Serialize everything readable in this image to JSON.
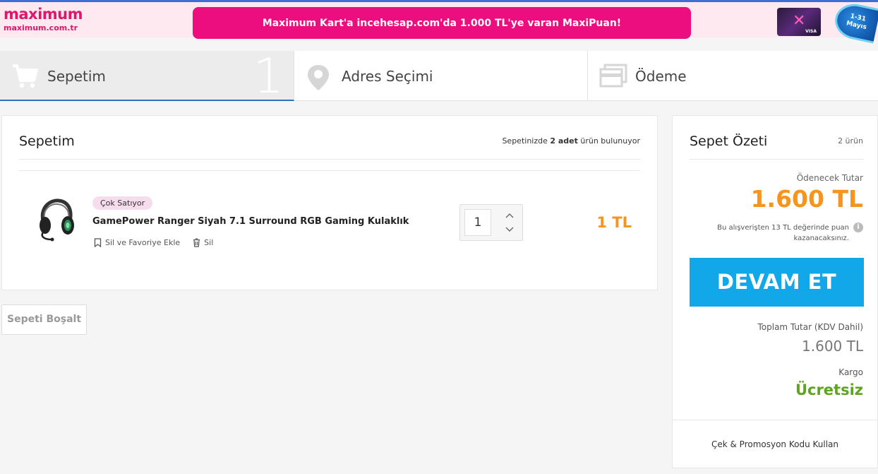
{
  "banner": {
    "brand_logo": "maximum",
    "brand_url": "maximum.com.tr",
    "promo_text": "Maximum Kart'a incehesap.com'da 1.000 TL'ye varan MaxiPuan!",
    "date_line1": "1-31",
    "date_line2": "Mayıs",
    "accent_color": "#ec0d7e"
  },
  "steps": [
    {
      "label": "Sepetim",
      "number": "1",
      "icon": "cart-icon",
      "active": true
    },
    {
      "label": "Adres Seçimi",
      "icon": "location-pin-icon",
      "active": false
    },
    {
      "label": "Ödeme",
      "icon": "payment-card-icon",
      "active": false
    }
  ],
  "cart": {
    "title": "Sepetim",
    "count_prefix": "Sepetinizde ",
    "count_bold": "2 adet",
    "count_suffix": " ürün bulunuyor",
    "item": {
      "badge": "Çok Satıyor",
      "name": "GamePower Ranger Siyah 7.1 Surround RGB Gaming Kulaklık",
      "save_label": "Sil ve Favoriye Ekle",
      "delete_label": "Sil",
      "quantity": "1",
      "price": "1 TL"
    },
    "empty_label": "Sepeti Boşalt"
  },
  "summary": {
    "title": "Sepet Özeti",
    "count": "2 ürün",
    "pay_label": "Ödenecek Tutar",
    "pay_amount": "1.600 TL",
    "points_text": "Bu alışverişten 13 TL değerinde puan kazanacaksınız.",
    "cta_label": "DEVAM ET",
    "total_label": "Toplam Tutar (KDV Dahil)",
    "total_amount": "1.600 TL",
    "shipping_label": "Kargo",
    "shipping_value": "Ücretsiz",
    "coupon_label": "Çek & Promosyon Kodu Kullan",
    "cta_color": "#11a7e8",
    "price_color": "#f7941d",
    "free_color": "#5fa321"
  }
}
